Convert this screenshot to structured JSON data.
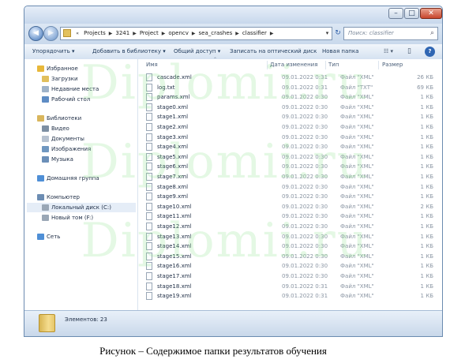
{
  "window": {
    "controls": {
      "minimize": "–",
      "maximize": "□",
      "close": "✕"
    }
  },
  "nav": {
    "back_icon": "arrow-left-icon",
    "forward_icon": "arrow-right-icon",
    "back_glyph": "◀",
    "forward_glyph": "▶",
    "path": [
      "Projects",
      "3241",
      "Project",
      "opencv",
      "sea_crashes",
      "classifier"
    ],
    "prefix": "«",
    "refresh_glyph": "↻",
    "dropdown_glyph": "▾",
    "search_placeholder": "Поиск: classifier",
    "search_glyph": "⌕"
  },
  "toolbar": {
    "organize": "Упорядочить ▾",
    "add_library": "Добавить в библиотеку ▾",
    "share": "Общий доступ ▾",
    "burn": "Записать на оптический диск",
    "new_folder": "Новая папка",
    "view_glyph": "☷ ▾",
    "pane_glyph": "▯",
    "help_glyph": "?"
  },
  "sidebar": {
    "items": [
      {
        "label": "Избранное",
        "icon": "star-icon",
        "color": "#e8b83a"
      },
      {
        "label": "Загрузки",
        "icon": "downloads-folder-icon",
        "color": "#e1bf5c"
      },
      {
        "label": "Недавние места",
        "icon": "recent-places-icon",
        "color": "#9fb3c9"
      },
      {
        "label": "Рабочий стол",
        "icon": "desktop-icon",
        "color": "#5e8cc4"
      },
      {
        "label": "Библиотеки",
        "icon": "libraries-icon",
        "color": "#d9b65c"
      },
      {
        "label": "Видео",
        "icon": "video-icon",
        "color": "#7d8fa3"
      },
      {
        "label": "Документы",
        "icon": "documents-icon",
        "color": "#b8c3d1"
      },
      {
        "label": "Изображения",
        "icon": "pictures-icon",
        "color": "#6f97c0"
      },
      {
        "label": "Музыка",
        "icon": "music-icon",
        "color": "#6b8fb8"
      },
      {
        "label": "Домашняя группа",
        "icon": "homegroup-icon",
        "color": "#4f8fd6"
      },
      {
        "label": "Компьютер",
        "icon": "computer-icon",
        "color": "#6c8db3"
      },
      {
        "label": "Локальный диск (C:)",
        "icon": "drive-icon",
        "color": "#9aa7b6"
      },
      {
        "label": "Новый том (F:)",
        "icon": "drive-icon",
        "color": "#9aa7b6"
      },
      {
        "label": "Сеть",
        "icon": "network-icon",
        "color": "#4f8fd6"
      }
    ]
  },
  "columns": {
    "name": "Имя",
    "date": "Дата изменения",
    "type": "Тип",
    "size": "Размер"
  },
  "files": [
    {
      "name": "cascade.xml",
      "date": "09.01.2022 0:31",
      "type": "Файл \"XML\"",
      "size": "26 КБ"
    },
    {
      "name": "log.txt",
      "date": "09.01.2022 0:31",
      "type": "Файл \"TXT\"",
      "size": "69 КБ"
    },
    {
      "name": "params.xml",
      "date": "09.01.2022 0:30",
      "type": "Файл \"XML\"",
      "size": "1 КБ"
    },
    {
      "name": "stage0.xml",
      "date": "09.01.2022 0:30",
      "type": "Файл \"XML\"",
      "size": "1 КБ"
    },
    {
      "name": "stage1.xml",
      "date": "09.01.2022 0:30",
      "type": "Файл \"XML\"",
      "size": "1 КБ"
    },
    {
      "name": "stage2.xml",
      "date": "09.01.2022 0:30",
      "type": "Файл \"XML\"",
      "size": "1 КБ"
    },
    {
      "name": "stage3.xml",
      "date": "09.01.2022 0:30",
      "type": "Файл \"XML\"",
      "size": "1 КБ"
    },
    {
      "name": "stage4.xml",
      "date": "09.01.2022 0:30",
      "type": "Файл \"XML\"",
      "size": "1 КБ"
    },
    {
      "name": "stage5.xml",
      "date": "09.01.2022 0:30",
      "type": "Файл \"XML\"",
      "size": "1 КБ"
    },
    {
      "name": "stage6.xml",
      "date": "09.01.2022 0:30",
      "type": "Файл \"XML\"",
      "size": "1 КБ"
    },
    {
      "name": "stage7.xml",
      "date": "09.01.2022 0:30",
      "type": "Файл \"XML\"",
      "size": "1 КБ"
    },
    {
      "name": "stage8.xml",
      "date": "09.01.2022 0:30",
      "type": "Файл \"XML\"",
      "size": "1 КБ"
    },
    {
      "name": "stage9.xml",
      "date": "09.01.2022 0:30",
      "type": "Файл \"XML\"",
      "size": "1 КБ"
    },
    {
      "name": "stage10.xml",
      "date": "09.01.2022 0:30",
      "type": "Файл \"XML\"",
      "size": "2 КБ"
    },
    {
      "name": "stage11.xml",
      "date": "09.01.2022 0:30",
      "type": "Файл \"XML\"",
      "size": "1 КБ"
    },
    {
      "name": "stage12.xml",
      "date": "09.01.2022 0:30",
      "type": "Файл \"XML\"",
      "size": "1 КБ"
    },
    {
      "name": "stage13.xml",
      "date": "09.01.2022 0:30",
      "type": "Файл \"XML\"",
      "size": "1 КБ"
    },
    {
      "name": "stage14.xml",
      "date": "09.01.2022 0:30",
      "type": "Файл \"XML\"",
      "size": "1 КБ"
    },
    {
      "name": "stage15.xml",
      "date": "09.01.2022 0:30",
      "type": "Файл \"XML\"",
      "size": "1 КБ"
    },
    {
      "name": "stage16.xml",
      "date": "09.01.2022 0:30",
      "type": "Файл \"XML\"",
      "size": "1 КБ"
    },
    {
      "name": "stage17.xml",
      "date": "09.01.2022 0:30",
      "type": "Файл \"XML\"",
      "size": "1 КБ"
    },
    {
      "name": "stage18.xml",
      "date": "09.01.2022 0:31",
      "type": "Файл \"XML\"",
      "size": "1 КБ"
    },
    {
      "name": "stage19.xml",
      "date": "09.01.2022 0:31",
      "type": "Файл \"XML\"",
      "size": "1 КБ"
    }
  ],
  "status": {
    "count": "Элементов: 23"
  },
  "watermark": {
    "text": "Diplomii.ru",
    "color": "#86e286"
  },
  "caption": "Рисунок – Содержимое папки результатов обучения"
}
